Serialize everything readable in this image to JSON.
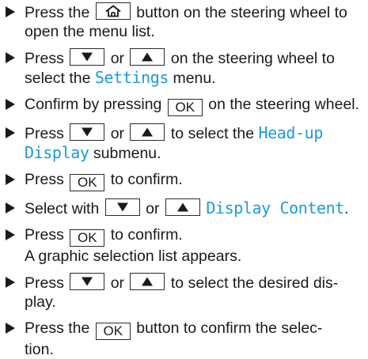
{
  "steps": {
    "s1": {
      "a": "Press the",
      "b": "button on the steering wheel to open the menu list."
    },
    "s2": {
      "a": "Press",
      "b": "or",
      "c": "on the steering wheel to select the",
      "hl": "Settings",
      "d": "menu."
    },
    "s3": {
      "a": "Confirm by pressing",
      "btn": "OK",
      "b": "on the steering wheel."
    },
    "s4": {
      "a": "Press",
      "b": "or",
      "c": "to select the",
      "hl": "Head-up Display",
      "d": "submenu."
    },
    "s5": {
      "a": "Press",
      "btn": "OK",
      "b": "to confirm."
    },
    "s6": {
      "a": "Select with",
      "b": "or",
      "hl": "Display Content",
      "d": "."
    },
    "s7": {
      "a": "Press",
      "btn": "OK",
      "b": "to confirm.",
      "result": "A graphic selection list appears."
    },
    "s8": {
      "a": "Press",
      "b": "or",
      "c": "to select the desired dis-",
      "d": "play."
    },
    "s9": {
      "a": "Press the",
      "btn": "OK",
      "b": "button to confirm the selec-",
      "c": "tion."
    }
  },
  "colors": {
    "highlight": "#1e9ad6",
    "text": "#1a1a1a"
  },
  "icons": {
    "home": "home-icon",
    "down": "down-arrow-icon",
    "up": "up-arrow-icon",
    "bullet": "triangle-bullet-icon"
  }
}
